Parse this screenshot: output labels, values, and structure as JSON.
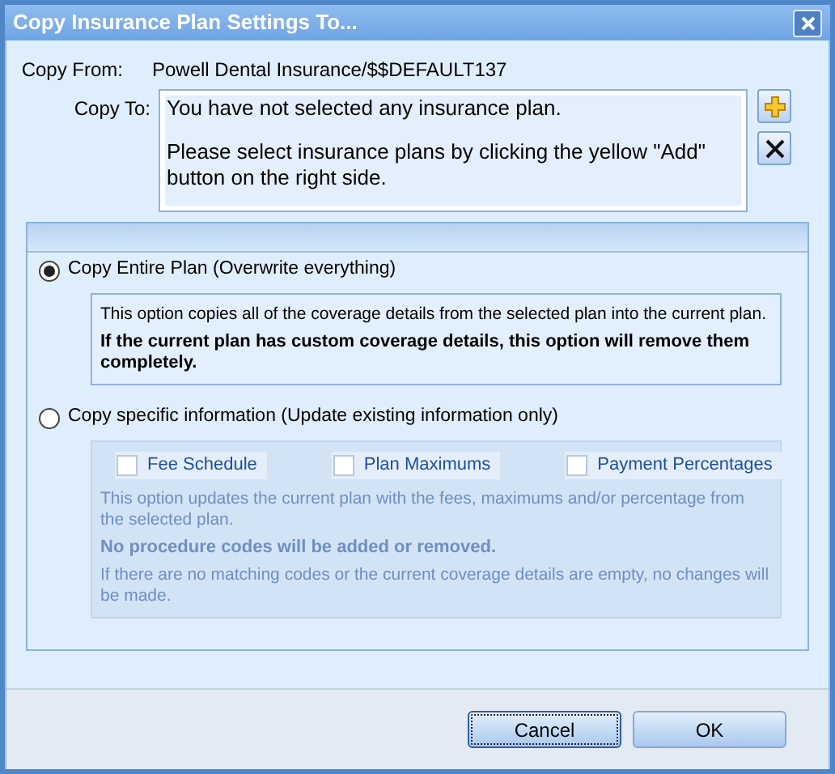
{
  "window": {
    "title": "Copy Insurance Plan Settings To..."
  },
  "copy_from": {
    "label": "Copy From:",
    "value": "Powell Dental Insurance/$$DEFAULT137"
  },
  "copy_to": {
    "label": "Copy To:",
    "lines": [
      "You have not selected any insurance plan.",
      "Please select insurance plans by clicking the yellow \"Add\" button on the right side."
    ]
  },
  "options": [
    {
      "label": "Copy Entire Plan (Overwrite everything)",
      "selected": true,
      "disabled": false,
      "paragraphs": [
        {
          "text": "This option copies all of the coverage details from the selected plan into the current plan.",
          "bold": false
        },
        {
          "text": "If the current plan has custom coverage details, this option will remove them completely.",
          "bold": true
        }
      ]
    },
    {
      "label": "Copy specific information (Update existing information only)",
      "selected": false,
      "disabled": true,
      "checkboxes": [
        {
          "label": "Fee Schedule",
          "checked": false
        },
        {
          "label": "Plan Maximums",
          "checked": false
        },
        {
          "label": "Payment Percentages",
          "checked": false
        }
      ],
      "paragraphs": [
        {
          "text": "This option updates the current plan with the fees, maximums and/or percentage from the selected plan.",
          "bold": false
        },
        {
          "text": "No procedure codes will be added or removed.",
          "bold": true
        },
        {
          "text": "If there are no matching codes or the current coverage details are empty, no changes will be made.",
          "bold": false
        }
      ]
    }
  ],
  "buttons": [
    {
      "label": "Cancel",
      "focused": true
    },
    {
      "label": "OK",
      "focused": false
    }
  ]
}
